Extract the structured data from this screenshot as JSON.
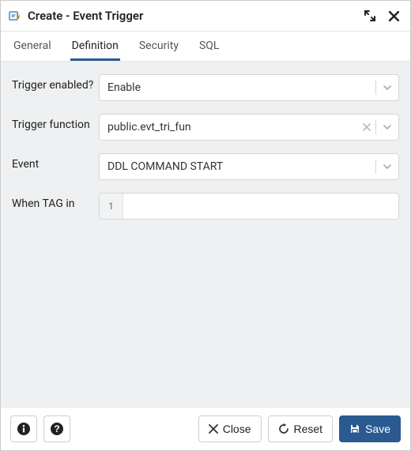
{
  "window": {
    "title": "Create - Event Trigger"
  },
  "tabs": {
    "general": "General",
    "definition": "Definition",
    "security": "Security",
    "sql": "SQL"
  },
  "form": {
    "trigger_enabled": {
      "label": "Trigger enabled?",
      "value": "Enable"
    },
    "trigger_function": {
      "label": "Trigger function",
      "value": "public.evt_tri_fun"
    },
    "event": {
      "label": "Event",
      "value": "DDL COMMAND START"
    },
    "when_tag": {
      "label": "When TAG in",
      "counter": "1",
      "value": ""
    }
  },
  "footer": {
    "close": "Close",
    "reset": "Reset",
    "save": "Save"
  }
}
